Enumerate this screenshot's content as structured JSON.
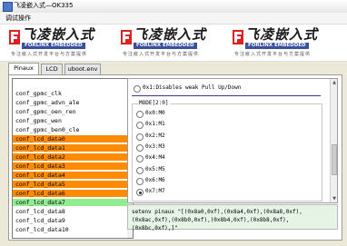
{
  "window": {
    "title": "飞凌嵌入式—OK335"
  },
  "menu": {
    "items": [
      "调试操作"
    ]
  },
  "banner": {
    "logo_text": "飞凌嵌入式",
    "brand_text": "FORLINX EMBEDDED",
    "slogan": "专注嵌入式开发平台与方案提供"
  },
  "tabs": [
    "Pinaux",
    "LCD",
    "uboot.env"
  ],
  "pin_list": [
    {
      "label": "conf_gpmc_clk",
      "state": "normal"
    },
    {
      "label": "conf_gpmc_advn_ale",
      "state": "normal"
    },
    {
      "label": "conf_gpmc_oen_ren",
      "state": "normal"
    },
    {
      "label": "conf_gpmc_wen",
      "state": "normal"
    },
    {
      "label": "conf_gpmc_ben0_cle",
      "state": "normal"
    },
    {
      "label": "conf_lcd_data0",
      "state": "orange"
    },
    {
      "label": "conf_lcd_data1",
      "state": "orange"
    },
    {
      "label": "conf_lcd_data2",
      "state": "orange"
    },
    {
      "label": "conf_lcd_data3",
      "state": "orange"
    },
    {
      "label": "conf_lcd_data4",
      "state": "orange"
    },
    {
      "label": "conf_lcd_data5",
      "state": "orange"
    },
    {
      "label": "conf_lcd_data6",
      "state": "orange"
    },
    {
      "label": "conf_lcd_data7",
      "state": "green"
    },
    {
      "label": "conf_lcd_data8",
      "state": "normal"
    },
    {
      "label": "conf_lcd_data9",
      "state": "normal"
    },
    {
      "label": "conf_lcd_data10",
      "state": "normal"
    }
  ],
  "pull_option": {
    "label": "0x1:Disables weak Pull Up/Down",
    "selected": false
  },
  "mode": {
    "title": "MODE[2:0]",
    "options": [
      {
        "label": "0x0:M0",
        "selected": false
      },
      {
        "label": "0x1:M1",
        "selected": false
      },
      {
        "label": "0x2:M2",
        "selected": false
      },
      {
        "label": "0x3:M3",
        "selected": false
      },
      {
        "label": "0x4:M4",
        "selected": false
      },
      {
        "label": "0x5:M5",
        "selected": false
      },
      {
        "label": "0x6:M6",
        "selected": false
      },
      {
        "label": "0x7:M7",
        "selected": true
      }
    ]
  },
  "command": {
    "text": "setenv pinaux \"[(0x8a0,0xf),(0x8a4,0xf),(0x8a8,0xf),(0x8ac,0xf),(0x8b0,0xf),(0x8b4,0xf),(0x8b8,0xf),(0x8bc,0xf),]\""
  },
  "colors": {
    "highlight_orange": "#ff8c00",
    "highlight_green": "#90ee90",
    "command_bg": "#e6f4e6"
  }
}
